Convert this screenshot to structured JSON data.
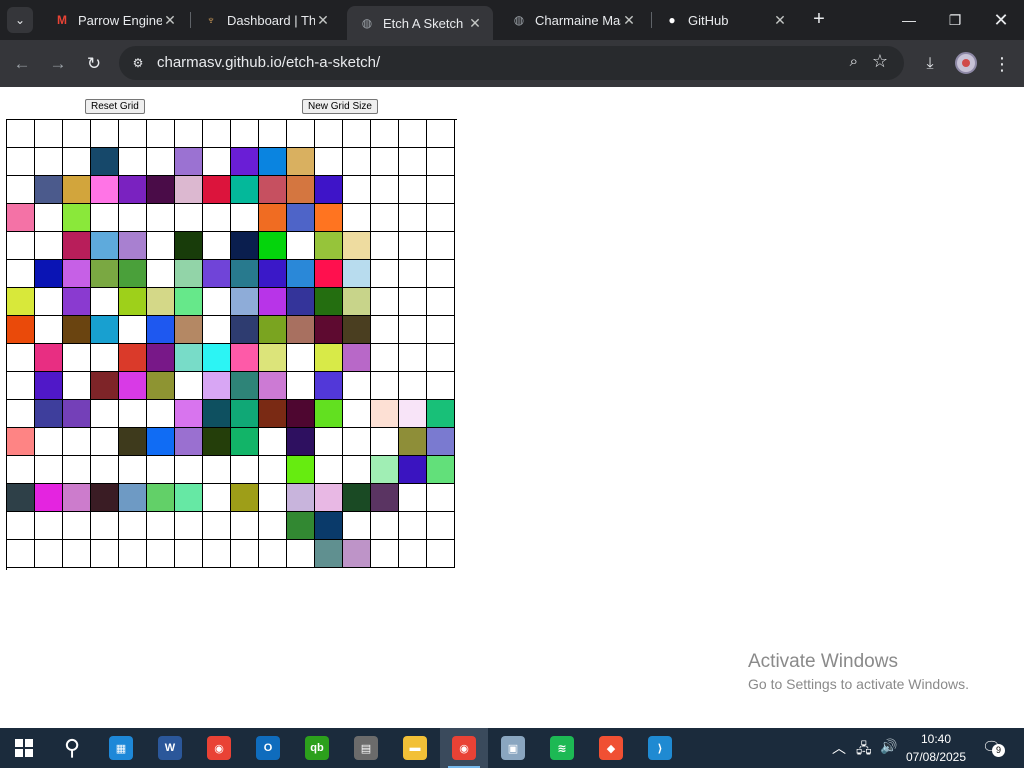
{
  "browser": {
    "tabs": [
      {
        "title": "Parrow Engineer",
        "icon": "gmail-icon",
        "color": "#ea4335",
        "glyph": "M"
      },
      {
        "title": "Dashboard | The",
        "icon": "odin-icon",
        "color": "#d9a35b",
        "glyph": "♆"
      },
      {
        "title": "Etch A Sketch",
        "icon": "globe-icon",
        "color": "#9aa0a6",
        "glyph": "◍"
      },
      {
        "title": "Charmaine Mas",
        "icon": "globe-icon",
        "color": "#9aa0a6",
        "glyph": "◍"
      },
      {
        "title": "GitHub",
        "icon": "github-icon",
        "color": "#ffffff",
        "glyph": "●"
      }
    ],
    "active_tab": 2,
    "url": "charmasv.github.io/etch-a-sketch/"
  },
  "page": {
    "reset_label": "Reset Grid",
    "new_size_label": "New Grid Size"
  },
  "grid": {
    "size": 16,
    "cells": [
      [
        "#ffffff",
        "#ffffff",
        "#ffffff",
        "#ffffff",
        "#ffffff",
        "#ffffff",
        "#ffffff",
        "#ffffff",
        "#ffffff",
        "#ffffff",
        "#ffffff",
        "#ffffff",
        "#ffffff",
        "#ffffff",
        "#ffffff",
        "#ffffff"
      ],
      [
        "#ffffff",
        "#ffffff",
        "#ffffff",
        "#16486a",
        "#ffffff",
        "#ffffff",
        "#9b72d2",
        "#ffffff",
        "#6a1ed6",
        "#0a84e0",
        "#d9b060",
        "#ffffff",
        "#ffffff",
        "#ffffff",
        "#ffffff",
        "#ffffff"
      ],
      [
        "#ffffff",
        "#4b5a8c",
        "#d2a53c",
        "#ff74e6",
        "#7a22c0",
        "#4a0c48",
        "#dcb8d0",
        "#dc143c",
        "#04b89a",
        "#c65060",
        "#d47640",
        "#3e14c8",
        "#ffffff",
        "#ffffff",
        "#ffffff",
        "#ffffff"
      ],
      [
        "#f472a6",
        "#ffffff",
        "#8ae83a",
        "#ffffff",
        "#ffffff",
        "#ffffff",
        "#ffffff",
        "#ffffff",
        "#ffffff",
        "#f06c22",
        "#4e64c8",
        "#ff7420",
        "#ffffff",
        "#ffffff",
        "#ffffff",
        "#ffffff"
      ],
      [
        "#ffffff",
        "#ffffff",
        "#b81e5a",
        "#5eaadc",
        "#a880d0",
        "#ffffff",
        "#183c0a",
        "#ffffff",
        "#0a1e4e",
        "#04d40c",
        "#ffffff",
        "#96c43a",
        "#eedca0",
        "#ffffff",
        "#ffffff",
        "#ffffff"
      ],
      [
        "#ffffff",
        "#0a14b4",
        "#c660e6",
        "#7aa842",
        "#4aa03a",
        "#ffffff",
        "#92d4a8",
        "#7044d8",
        "#287a8e",
        "#3a18c8",
        "#2a88d8",
        "#ff104e",
        "#b8dcee",
        "#ffffff",
        "#ffffff",
        "#ffffff"
      ],
      [
        "#d8e83a",
        "#ffffff",
        "#8a3ad0",
        "#ffffff",
        "#9ed01a",
        "#d4d888",
        "#66e88a",
        "#ffffff",
        "#8eacd8",
        "#b834e8",
        "#34349a",
        "#246e10",
        "#c8d48a",
        "#ffffff",
        "#ffffff",
        "#ffffff"
      ],
      [
        "#ea4a0a",
        "#ffffff",
        "#6a4410",
        "#18a0d0",
        "#ffffff",
        "#1e58f0",
        "#b48864",
        "#ffffff",
        "#2e3c70",
        "#7aa420",
        "#a87060",
        "#5e0a30",
        "#4a3e20",
        "#ffffff",
        "#ffffff",
        "#ffffff"
      ],
      [
        "#ffffff",
        "#e82e82",
        "#ffffff",
        "#ffffff",
        "#da3a2a",
        "#781888",
        "#78dcc8",
        "#2cf4f4",
        "#fe5aa8",
        "#dce47a",
        "#ffffff",
        "#d8ea48",
        "#b868c8",
        "#ffffff",
        "#ffffff",
        "#ffffff"
      ],
      [
        "#ffffff",
        "#5018c8",
        "#ffffff",
        "#7e2428",
        "#d83ae6",
        "#8e9432",
        "#ffffff",
        "#d8a6f4",
        "#2e8478",
        "#cc7ad4",
        "#ffffff",
        "#5238d8",
        "#ffffff",
        "#ffffff",
        "#ffffff",
        "#ffffff"
      ],
      [
        "#ffffff",
        "#3e3e9c",
        "#7440b8",
        "#ffffff",
        "#ffffff",
        "#ffffff",
        "#d874ee",
        "#0e5060",
        "#10a876",
        "#7a2a14",
        "#4e0630",
        "#62e020",
        "#ffffff",
        "#fde0d4",
        "#f8e4f8",
        "#18c078"
      ],
      [
        "#fe8484",
        "#ffffff",
        "#ffffff",
        "#ffffff",
        "#3e3a1c",
        "#106cf4",
        "#9a70d0",
        "#243e0a",
        "#12b468",
        "#ffffff",
        "#2e1060",
        "#ffffff",
        "#ffffff",
        "#ffffff",
        "#8e8e38",
        "#7a7ad0"
      ],
      [
        "#ffffff",
        "#ffffff",
        "#ffffff",
        "#ffffff",
        "#ffffff",
        "#ffffff",
        "#ffffff",
        "#ffffff",
        "#ffffff",
        "#ffffff",
        "#66ec10",
        "#ffffff",
        "#ffffff",
        "#a0eeb4",
        "#3a14c0",
        "#62e07a"
      ],
      [
        "#2e4048",
        "#e424e0",
        "#cc7ccc",
        "#3a1c24",
        "#6e9ac4",
        "#62d068",
        "#66e8a4",
        "#ffffff",
        "#9e9e18",
        "#ffffff",
        "#c8b4dc",
        "#e8b8e4",
        "#1a4a24",
        "#5a3462",
        "#ffffff",
        "#ffffff"
      ],
      [
        "#ffffff",
        "#ffffff",
        "#ffffff",
        "#ffffff",
        "#ffffff",
        "#ffffff",
        "#ffffff",
        "#ffffff",
        "#ffffff",
        "#ffffff",
        "#328832",
        "#0a3a6a",
        "#ffffff",
        "#ffffff",
        "#ffffff",
        "#ffffff"
      ],
      [
        "#ffffff",
        "#ffffff",
        "#ffffff",
        "#ffffff",
        "#ffffff",
        "#ffffff",
        "#ffffff",
        "#ffffff",
        "#ffffff",
        "#ffffff",
        "#ffffff",
        "#609090",
        "#be94c8",
        "#ffffff",
        "#ffffff",
        "#ffffff"
      ]
    ]
  },
  "watermark": {
    "title": "Activate Windows",
    "subtitle": "Go to Settings to activate Windows."
  },
  "taskbar": {
    "apps": [
      {
        "name": "search-icon",
        "glyph": "⚲",
        "color": "transparent"
      },
      {
        "name": "store-icon",
        "glyph": "▦",
        "color": "#1e88d8"
      },
      {
        "name": "word-icon",
        "glyph": "W",
        "color": "#2b579a"
      },
      {
        "name": "chrome-icon",
        "glyph": "◉",
        "color": "#e94235"
      },
      {
        "name": "outlook-icon",
        "glyph": "O",
        "color": "#0f6cbd"
      },
      {
        "name": "quickbooks-icon",
        "glyph": "qb",
        "color": "#2ca01c"
      },
      {
        "name": "calculator-icon",
        "glyph": "▤",
        "color": "#6b6b6b"
      },
      {
        "name": "file-explorer-icon",
        "glyph": "▬",
        "color": "#f2c037"
      },
      {
        "name": "chrome-profile-icon",
        "glyph": "◉",
        "color": "#e94235"
      },
      {
        "name": "photos-icon",
        "glyph": "▣",
        "color": "#8aa6c0"
      },
      {
        "name": "spotify-icon",
        "glyph": "≋",
        "color": "#1db954"
      },
      {
        "name": "git-icon",
        "glyph": "◆",
        "color": "#f05033"
      },
      {
        "name": "vscode-icon",
        "glyph": "⟩",
        "color": "#1f8ad2"
      }
    ],
    "active_app": 8,
    "time": "10:40",
    "date": "07/08/2025",
    "notification_count": "9"
  }
}
